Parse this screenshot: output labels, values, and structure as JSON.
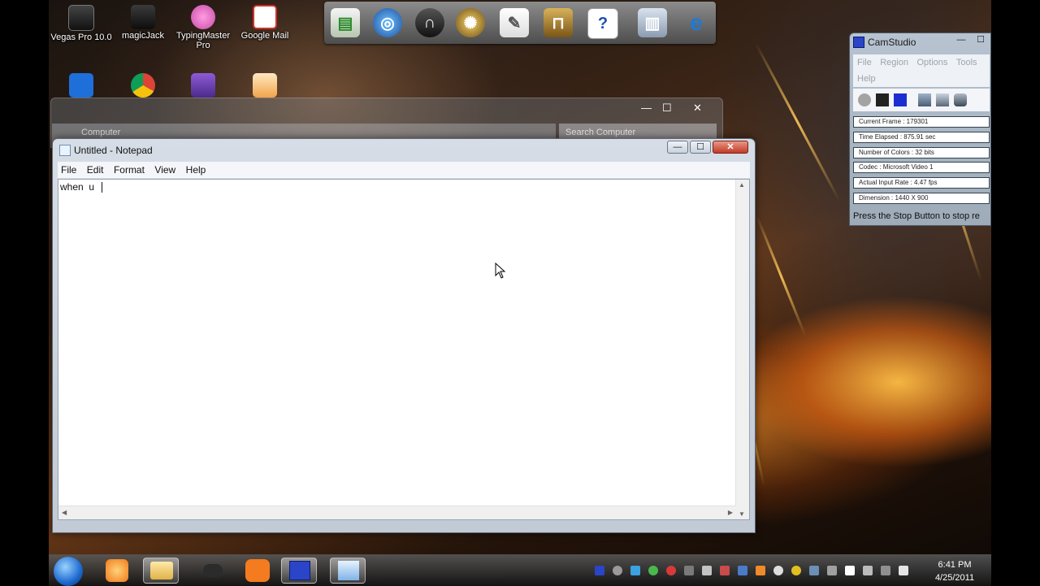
{
  "desktop": {
    "icons": [
      {
        "label": "Vegas Pro 10.0"
      },
      {
        "label": "magicJack"
      },
      {
        "label": "TypingMaster Pro"
      },
      {
        "label": "Google Mail"
      },
      {
        "label": ""
      },
      {
        "label": ""
      },
      {
        "label": ""
      },
      {
        "label": ""
      }
    ],
    "ghost_window": {
      "address": "Computer",
      "search_placeholder": "Search Computer",
      "min_label": "—",
      "max_label": "☐",
      "close_label": "✕"
    }
  },
  "notepad": {
    "title": "Untitled - Notepad",
    "menu": [
      "File",
      "Edit",
      "Format",
      "View",
      "Help"
    ],
    "content": "when  u  ",
    "min_label": "—",
    "max_label": "☐",
    "close_label": "✕"
  },
  "camstudio": {
    "title": "CamStudio",
    "menu": [
      "File",
      "Region",
      "Options",
      "Tools",
      "Help"
    ],
    "stats": [
      "Current Frame : 179301",
      "Time Elapsed : 875.91 sec",
      "Number of Colors : 32 bits",
      "Codec : Microsoft Video 1",
      "Actual Input Rate : 4.47 fps",
      "Dimension : 1440 X 900"
    ],
    "status": "Press the Stop Button to stop re",
    "min_label": "—",
    "close_label": "☐"
  },
  "taskbar": {
    "clock_time": "6:41 PM",
    "clock_date": "4/25/2011"
  },
  "colors": {
    "notepad_close": "#c23a26",
    "taskbar": "#1e1e1e",
    "camstudio_logo": "#2a45c8"
  }
}
